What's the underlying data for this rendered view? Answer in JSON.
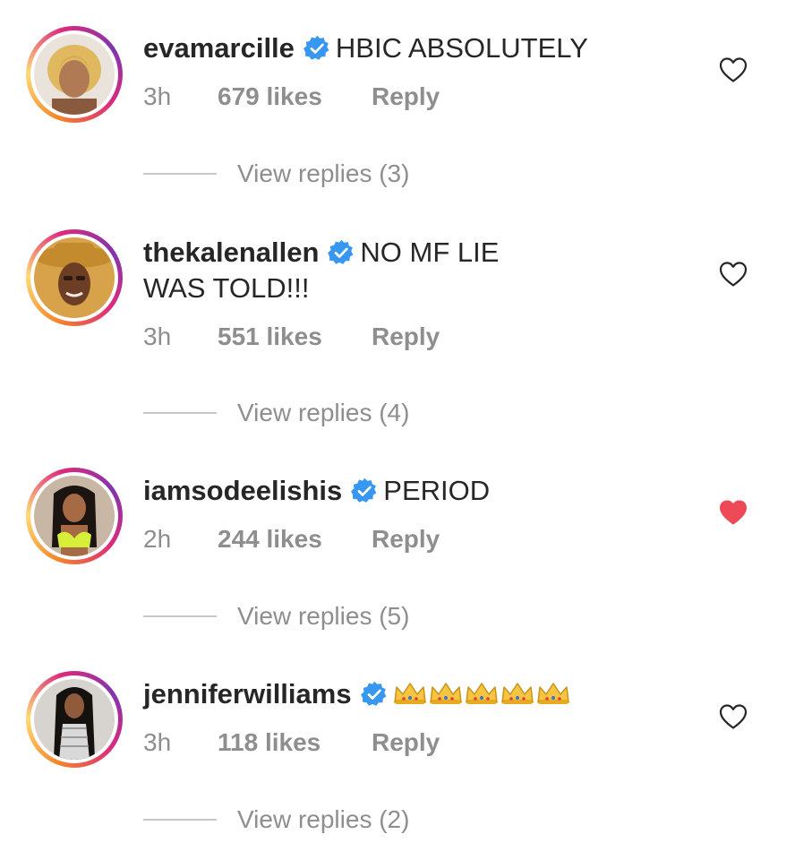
{
  "comments": [
    {
      "username": "evamarcille",
      "text": "HBIC ABSOLUTELY",
      "time": "3h",
      "likes": "679 likes",
      "reply": "Reply",
      "view_replies": "View replies (3)",
      "liked": false
    },
    {
      "username": "thekalenallen",
      "text": "NO MF LIE",
      "text_line2": "WAS TOLD!!!",
      "time": "3h",
      "likes": "551 likes",
      "reply": "Reply",
      "view_replies": "View replies (4)",
      "liked": false
    },
    {
      "username": "iamsodeelishis",
      "text": "PERIOD",
      "time": "2h",
      "likes": "244 likes",
      "reply": "Reply",
      "view_replies": "View replies (5)",
      "liked": true
    },
    {
      "username": "jenniferwilliams",
      "text": "👑👑👑👑👑",
      "time": "3h",
      "likes": "118 likes",
      "reply": "Reply",
      "view_replies": "View replies (2)",
      "liked": false
    }
  ],
  "colors": {
    "verified_blue": "#3897f0",
    "liked_red": "#ed4956",
    "muted_text": "#8e8e8e",
    "primary_text": "#262626"
  },
  "icons": {
    "verified": "verified-badge-icon",
    "heart_outline": "heart-outline-icon",
    "heart_filled": "heart-filled-icon",
    "crown": "crown-icon"
  }
}
